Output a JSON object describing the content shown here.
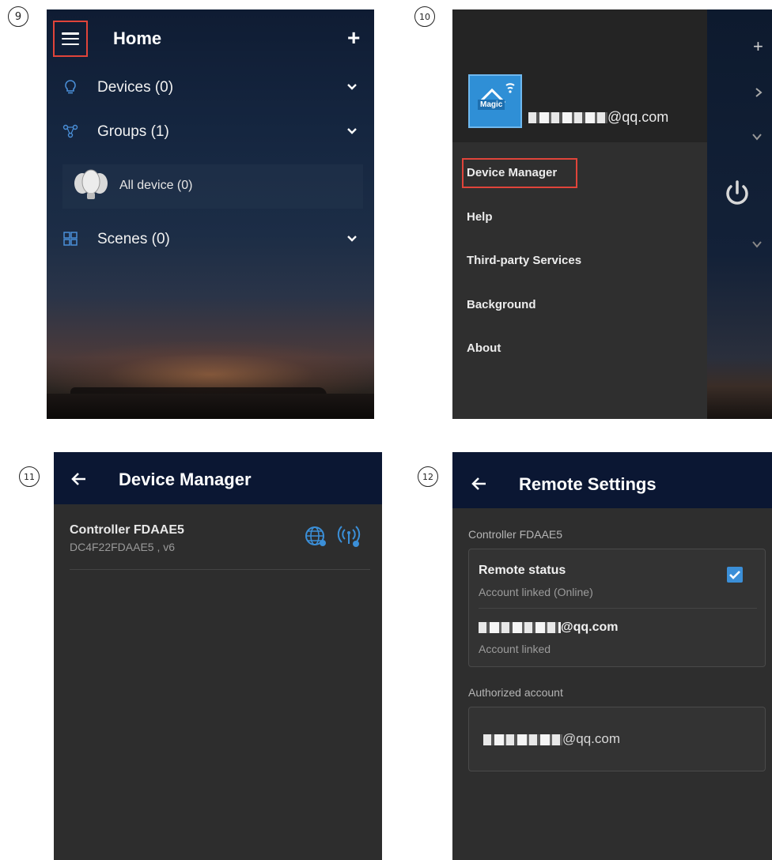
{
  "steps": [
    "9",
    "10",
    "11",
    "12"
  ],
  "panel9": {
    "title": "Home",
    "plus": "+",
    "rows": [
      {
        "label": "Devices (0)",
        "icon": "bulb-icon"
      },
      {
        "label": "Groups (1)",
        "icon": "groups-icon"
      },
      {
        "label": "Scenes (0)",
        "icon": "scenes-icon"
      }
    ],
    "sub_item": "All device (0)"
  },
  "panel10": {
    "logo_text": "Magic",
    "email_suffix": "@qq.com",
    "menu": [
      "Device Manager",
      "Help",
      "Third-party Services",
      "Background",
      "About"
    ],
    "strip_plus": "+"
  },
  "panel11": {
    "title": "Device Manager",
    "controller_name": "Controller  FDAAE5",
    "controller_mac": "DC4F22FDAAE5 , v6"
  },
  "panel12": {
    "title": "Remote Settings",
    "section1": "Controller  FDAAE5",
    "remote_status_title": "Remote status",
    "remote_status_sub": "Account linked (Online)",
    "email_suffix": "@qq.com",
    "account_linked": "Account linked",
    "section2": "Authorized account",
    "authorized_email_suffix": "@qq.com"
  },
  "colors": {
    "accent": "#3b8fd8",
    "highlight": "#e0443a",
    "appbar": "#0b1733"
  }
}
